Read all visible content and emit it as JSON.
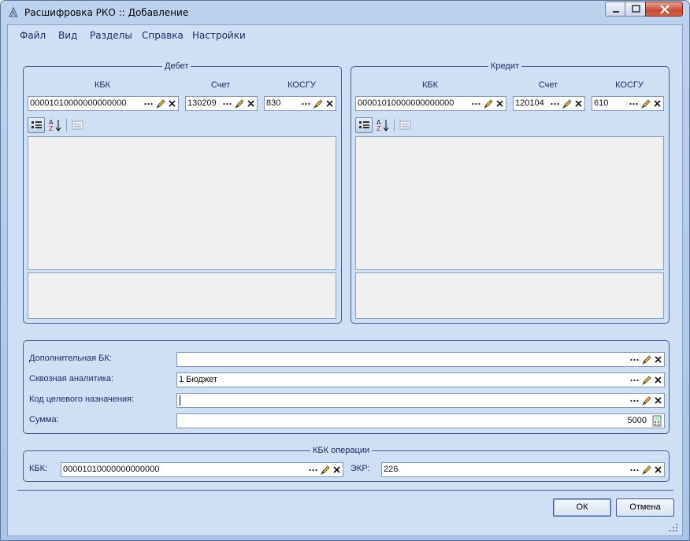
{
  "window": {
    "title": "Расшифровка РКО :: Добавление"
  },
  "menu": [
    {
      "label": "Файл"
    },
    {
      "label": "Вид"
    },
    {
      "label": "Разделы"
    },
    {
      "label": "Справка"
    },
    {
      "label": "Настройки"
    }
  ],
  "debit": {
    "title": "Дебет",
    "kbk_label": "КБК",
    "schet_label": "Счет",
    "kosgu_label": "КОСГУ",
    "kbk_value": "00001010000000000000",
    "schet_value": "130209",
    "kosgu_value": "830"
  },
  "credit": {
    "title": "Кредит",
    "kbk_label": "КБК",
    "schet_label": "Счет",
    "kosgu_label": "КОСГУ",
    "kbk_value": "00001010000000000000",
    "schet_value": "120104",
    "kosgu_value": "610"
  },
  "details": {
    "dop_bk_label": "Дополнительная БК:",
    "dop_bk_value": "",
    "skvoz_label": "Сквозная аналитика:",
    "skvoz_value": "1 Бюджет",
    "kod_label": "Код целевого назначения:",
    "kod_value": "",
    "summa_label": "Сумма:",
    "summa_value": "5000"
  },
  "kbk_op": {
    "title": "КБК операции",
    "kbk_label": "КБК:",
    "kbk_value": "00001010000000000000",
    "ekr_label": "ЭКР:",
    "ekr_value": "226"
  },
  "buttons": {
    "ok": "ОК",
    "cancel": "Отмена"
  },
  "icons": {
    "ellipsis": "ellipsis-icon",
    "edit": "pencil-icon",
    "clear": "close-x-icon",
    "calc": "calculator-icon"
  }
}
